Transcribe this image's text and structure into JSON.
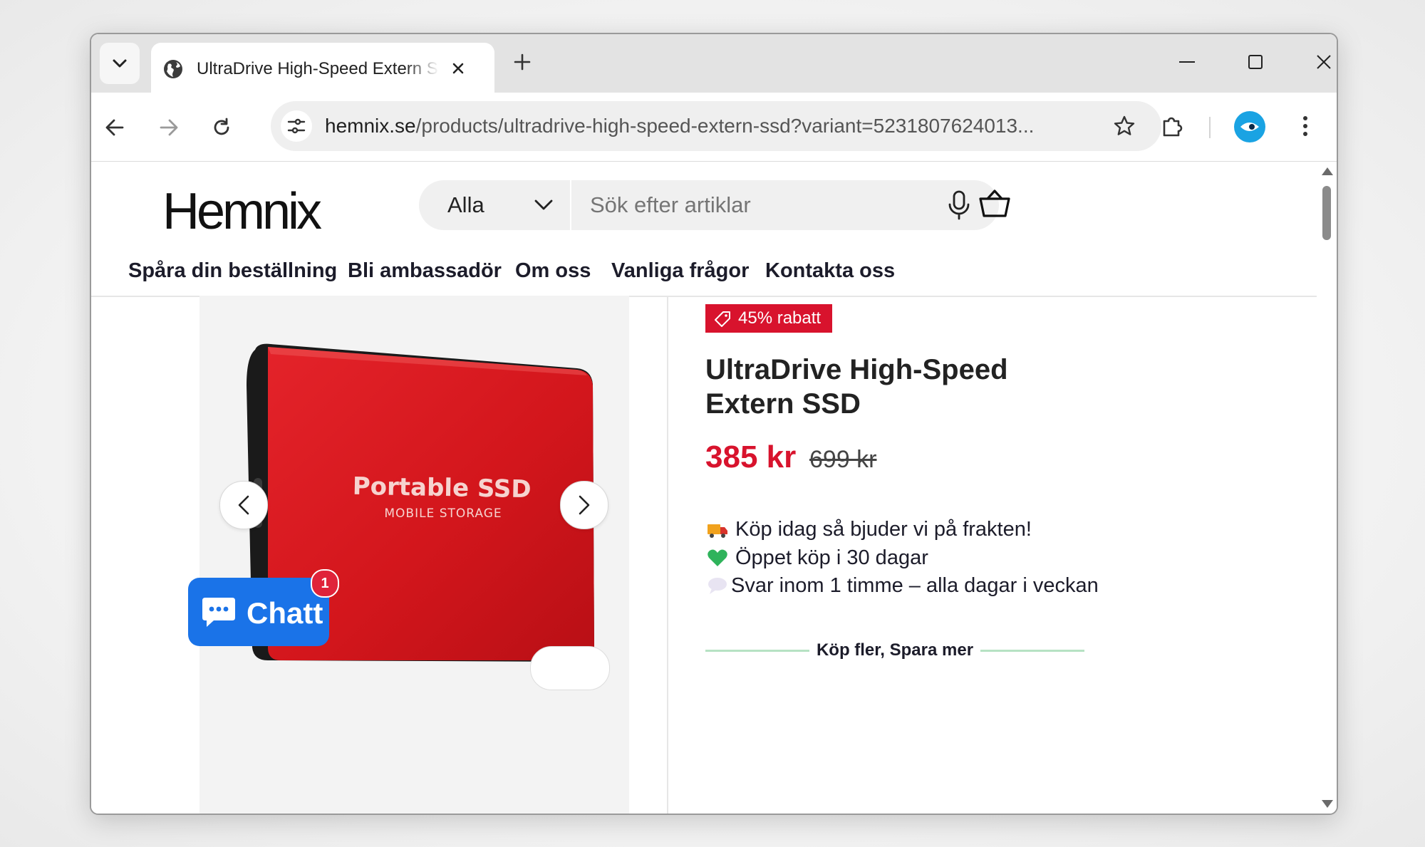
{
  "browser": {
    "tab_title": "UltraDrive High-Speed Extern SSD",
    "url_host": "hemnix.se",
    "url_path": "/products/ultradrive-high-speed-extern-ssd?variant=5231807624013..."
  },
  "header": {
    "logo": "Hemnix",
    "category_selected": "Alla",
    "search_placeholder": "Sök efter artiklar"
  },
  "nav": {
    "items": [
      "Spåra din beställning",
      "Bli ambassadör",
      "Om oss",
      "Vanliga frågor",
      "Kontakta oss"
    ]
  },
  "product": {
    "discount_badge": "45% rabatt",
    "title": "UltraDrive High-Speed Extern SSD",
    "price": "385 kr",
    "compare_price": "699 kr",
    "image_text_main": "Portable SSD",
    "image_text_sub": "MOBILE STORAGE",
    "perks": [
      "Köp idag så bjuder vi på frakten!",
      "Öppet köp i 30 dagar",
      "Svar inom 1 timme – alla dagar i veckan"
    ],
    "buy_more_label": "Köp fler, Spara mer"
  },
  "chat": {
    "label": "Chatt",
    "badge": "1"
  },
  "colors": {
    "accent_red": "#d8132d",
    "chat_blue": "#1a73e8",
    "product_red": "#d3161c"
  }
}
